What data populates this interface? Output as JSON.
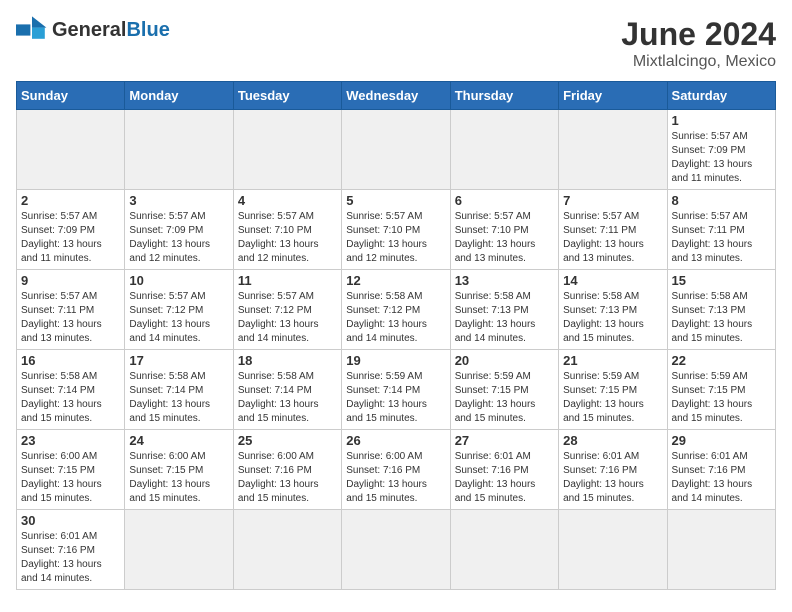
{
  "logo": {
    "general": "General",
    "blue": "Blue"
  },
  "title": "June 2024",
  "location": "Mixtlalcingo, Mexico",
  "weekdays": [
    "Sunday",
    "Monday",
    "Tuesday",
    "Wednesday",
    "Thursday",
    "Friday",
    "Saturday"
  ],
  "days": [
    {
      "num": "",
      "info": "",
      "empty": true
    },
    {
      "num": "",
      "info": "",
      "empty": true
    },
    {
      "num": "",
      "info": "",
      "empty": true
    },
    {
      "num": "",
      "info": "",
      "empty": true
    },
    {
      "num": "",
      "info": "",
      "empty": true
    },
    {
      "num": "",
      "info": "",
      "empty": true
    },
    {
      "num": "1",
      "info": "Sunrise: 5:57 AM\nSunset: 7:09 PM\nDaylight: 13 hours and 11 minutes.",
      "empty": false
    },
    {
      "num": "2",
      "info": "Sunrise: 5:57 AM\nSunset: 7:09 PM\nDaylight: 13 hours and 11 minutes.",
      "empty": false
    },
    {
      "num": "3",
      "info": "Sunrise: 5:57 AM\nSunset: 7:09 PM\nDaylight: 13 hours and 12 minutes.",
      "empty": false
    },
    {
      "num": "4",
      "info": "Sunrise: 5:57 AM\nSunset: 7:10 PM\nDaylight: 13 hours and 12 minutes.",
      "empty": false
    },
    {
      "num": "5",
      "info": "Sunrise: 5:57 AM\nSunset: 7:10 PM\nDaylight: 13 hours and 12 minutes.",
      "empty": false
    },
    {
      "num": "6",
      "info": "Sunrise: 5:57 AM\nSunset: 7:10 PM\nDaylight: 13 hours and 13 minutes.",
      "empty": false
    },
    {
      "num": "7",
      "info": "Sunrise: 5:57 AM\nSunset: 7:11 PM\nDaylight: 13 hours and 13 minutes.",
      "empty": false
    },
    {
      "num": "8",
      "info": "Sunrise: 5:57 AM\nSunset: 7:11 PM\nDaylight: 13 hours and 13 minutes.",
      "empty": false
    },
    {
      "num": "9",
      "info": "Sunrise: 5:57 AM\nSunset: 7:11 PM\nDaylight: 13 hours and 13 minutes.",
      "empty": false
    },
    {
      "num": "10",
      "info": "Sunrise: 5:57 AM\nSunset: 7:12 PM\nDaylight: 13 hours and 14 minutes.",
      "empty": false
    },
    {
      "num": "11",
      "info": "Sunrise: 5:57 AM\nSunset: 7:12 PM\nDaylight: 13 hours and 14 minutes.",
      "empty": false
    },
    {
      "num": "12",
      "info": "Sunrise: 5:58 AM\nSunset: 7:12 PM\nDaylight: 13 hours and 14 minutes.",
      "empty": false
    },
    {
      "num": "13",
      "info": "Sunrise: 5:58 AM\nSunset: 7:13 PM\nDaylight: 13 hours and 14 minutes.",
      "empty": false
    },
    {
      "num": "14",
      "info": "Sunrise: 5:58 AM\nSunset: 7:13 PM\nDaylight: 13 hours and 15 minutes.",
      "empty": false
    },
    {
      "num": "15",
      "info": "Sunrise: 5:58 AM\nSunset: 7:13 PM\nDaylight: 13 hours and 15 minutes.",
      "empty": false
    },
    {
      "num": "16",
      "info": "Sunrise: 5:58 AM\nSunset: 7:14 PM\nDaylight: 13 hours and 15 minutes.",
      "empty": false
    },
    {
      "num": "17",
      "info": "Sunrise: 5:58 AM\nSunset: 7:14 PM\nDaylight: 13 hours and 15 minutes.",
      "empty": false
    },
    {
      "num": "18",
      "info": "Sunrise: 5:58 AM\nSunset: 7:14 PM\nDaylight: 13 hours and 15 minutes.",
      "empty": false
    },
    {
      "num": "19",
      "info": "Sunrise: 5:59 AM\nSunset: 7:14 PM\nDaylight: 13 hours and 15 minutes.",
      "empty": false
    },
    {
      "num": "20",
      "info": "Sunrise: 5:59 AM\nSunset: 7:15 PM\nDaylight: 13 hours and 15 minutes.",
      "empty": false
    },
    {
      "num": "21",
      "info": "Sunrise: 5:59 AM\nSunset: 7:15 PM\nDaylight: 13 hours and 15 minutes.",
      "empty": false
    },
    {
      "num": "22",
      "info": "Sunrise: 5:59 AM\nSunset: 7:15 PM\nDaylight: 13 hours and 15 minutes.",
      "empty": false
    },
    {
      "num": "23",
      "info": "Sunrise: 6:00 AM\nSunset: 7:15 PM\nDaylight: 13 hours and 15 minutes.",
      "empty": false
    },
    {
      "num": "24",
      "info": "Sunrise: 6:00 AM\nSunset: 7:15 PM\nDaylight: 13 hours and 15 minutes.",
      "empty": false
    },
    {
      "num": "25",
      "info": "Sunrise: 6:00 AM\nSunset: 7:16 PM\nDaylight: 13 hours and 15 minutes.",
      "empty": false
    },
    {
      "num": "26",
      "info": "Sunrise: 6:00 AM\nSunset: 7:16 PM\nDaylight: 13 hours and 15 minutes.",
      "empty": false
    },
    {
      "num": "27",
      "info": "Sunrise: 6:01 AM\nSunset: 7:16 PM\nDaylight: 13 hours and 15 minutes.",
      "empty": false
    },
    {
      "num": "28",
      "info": "Sunrise: 6:01 AM\nSunset: 7:16 PM\nDaylight: 13 hours and 15 minutes.",
      "empty": false
    },
    {
      "num": "29",
      "info": "Sunrise: 6:01 AM\nSunset: 7:16 PM\nDaylight: 13 hours and 14 minutes.",
      "empty": false
    },
    {
      "num": "30",
      "info": "Sunrise: 6:01 AM\nSunset: 7:16 PM\nDaylight: 13 hours and 14 minutes.",
      "empty": false
    }
  ]
}
